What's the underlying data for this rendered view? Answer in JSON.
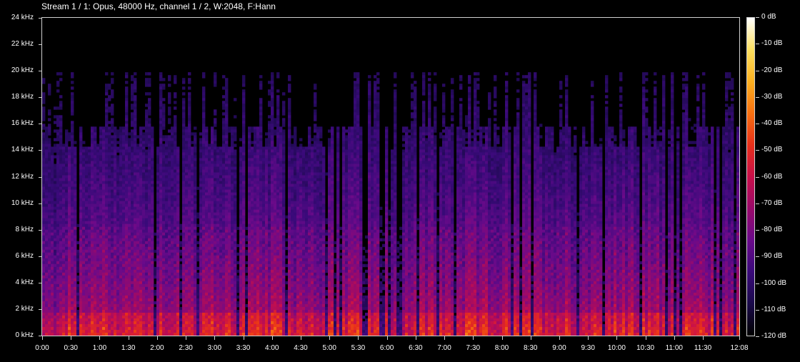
{
  "title": "Stream 1 / 1: Opus, 48000 Hz, channel 1 / 2, W:2048, F:Hann",
  "chart_data": {
    "type": "heatmap",
    "title": "Stream 1 / 1: Opus, 48000 Hz, channel 1 / 2, W:2048, F:Hann",
    "y_ticks": [
      "0 kHz",
      "2 kHz",
      "4 kHz",
      "6 kHz",
      "8 kHz",
      "10 kHz",
      "12 kHz",
      "14 kHz",
      "16 kHz",
      "18 kHz",
      "20 kHz",
      "22 kHz",
      "24 kHz"
    ],
    "x_ticks": [
      "0:00",
      "0:30",
      "1:00",
      "1:30",
      "2:00",
      "2:30",
      "3:00",
      "3:30",
      "4:00",
      "4:30",
      "5:00",
      "5:30",
      "6:00",
      "6:30",
      "7:00",
      "7:30",
      "8:00",
      "8:30",
      "9:00",
      "9:30",
      "10:00",
      "10:30",
      "11:00",
      "11:30",
      "12:08"
    ],
    "ylim_khz": [
      0,
      24
    ],
    "xlim_seconds": [
      0,
      728
    ],
    "colorbar_ticks": [
      "0 dB",
      "-10 dB",
      "-20 dB",
      "-30 dB",
      "-40 dB",
      "-50 dB",
      "-60 dB",
      "-70 dB",
      "-80 dB",
      "-90 dB",
      "-100 dB",
      "-110 dB",
      "-120 dB"
    ],
    "colorbar_range_db": [
      -120,
      0
    ],
    "colormap": [
      "#000000",
      "#1a0a4a",
      "#3a0a7a",
      "#6a0a8a",
      "#9a0a6a",
      "#c8104a",
      "#e8301a",
      "#f87010",
      "#fbb020",
      "#fde060",
      "#ffffff"
    ]
  }
}
